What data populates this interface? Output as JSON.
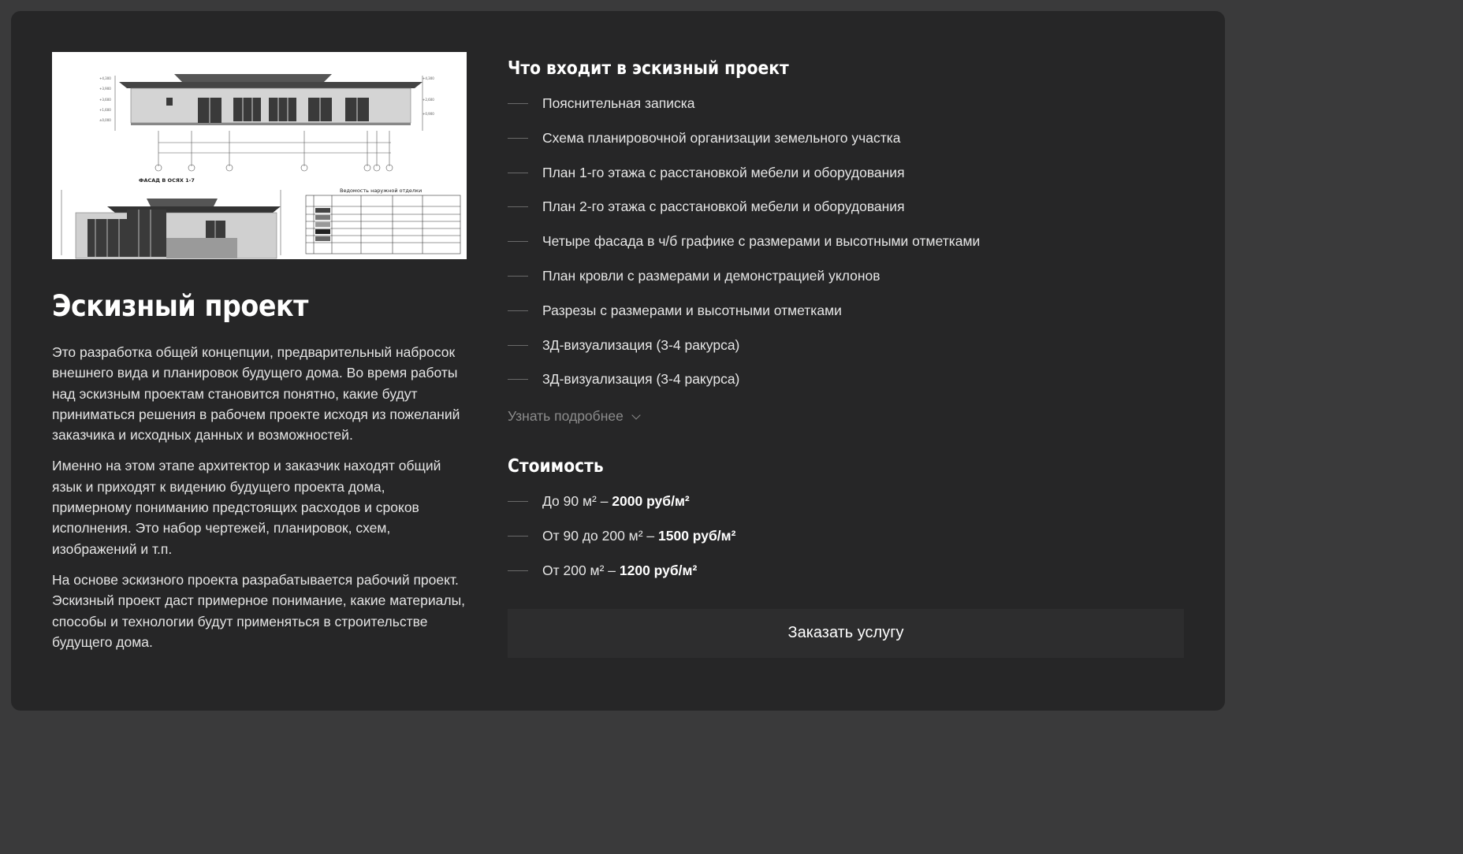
{
  "left": {
    "image_alt": "Чертёж фасада",
    "drawing_caption": "ФАСАД В ОСЯХ 1-7",
    "drawing_table_title": "Ведомость наружной отделки",
    "title": "Эскизный проект",
    "paragraphs": [
      "Это разработка общей концепции, предварительный набросок внешнего вида и планировок будущего дома. Во время работы над эскизным проектам становится понятно, какие будут приниматься решения в рабочем проекте исходя из пожеланий заказчика и исходных данных и возможностей.",
      "Именно на этом этапе архитектор и заказчик находят общий язык и приходят к видению будущего проекта дома, примерному пониманию предстоящих расходов и сроков исполнения. Это набор чертежей, планировок, схем, изображений и т.п.",
      "На основе эскизного проекта разрабатывается рабочий проект.  Эскизный проект даст примерное понимание, какие материалы, способы и технологии будут применяться в строительстве будущего дома."
    ]
  },
  "includes": {
    "title": "Что входит в эскизный проект",
    "items": [
      "Пояснительная записка",
      "Схема планировочной организации земельного участка",
      "План 1-го этажа с расстановкой мебели и оборудования",
      "План 2-го этажа с расстановкой мебели и оборудования",
      "Четыре фасада в ч/б графике с размерами и высотными отметками",
      "План кровли с размерами и демонстрацией уклонов",
      "Разрезы с размерами и высотными отметками",
      "3Д-визуализация (3-4 ракурса)",
      "3Д-визуализация (3-4 ракурса)"
    ],
    "more_label": "Узнать подробнее"
  },
  "cost": {
    "title": "Стоимость",
    "items": [
      {
        "label": "До 90 м² – ",
        "price": "2000 руб/м²"
      },
      {
        "label": "От 90 до 200 м² – ",
        "price": "1500 руб/м²"
      },
      {
        "label": "От 200 м² – ",
        "price": "1200 руб/м²"
      }
    ]
  },
  "order_button": "Заказать услугу",
  "icons": {
    "list_marker": "dash-icon",
    "more": "chevron-down-icon"
  },
  "colors": {
    "background": "#3a3a3b",
    "card": "#262627",
    "button": "#2d2d2e",
    "muted": "#8c8c8c"
  }
}
